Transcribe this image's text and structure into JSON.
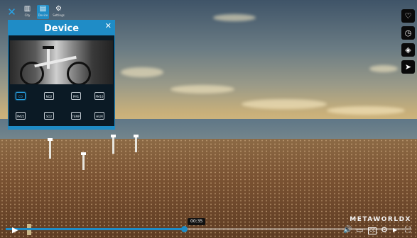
{
  "toolbar": {
    "items": [
      {
        "icon": "close-x-icon",
        "label": ""
      },
      {
        "icon": "building-icon",
        "label": "City"
      },
      {
        "icon": "device-icon",
        "label": "Device"
      },
      {
        "icon": "settings-icon",
        "label": "Settings"
      }
    ]
  },
  "device_panel": {
    "title": "Device",
    "close_label": "✕",
    "sensors": [
      {
        "label": "CO",
        "selected": true
      },
      {
        "label": "NO2",
        "selected": false
      },
      {
        "label": "PM1",
        "selected": false
      },
      {
        "label": "PM10",
        "selected": false
      },
      {
        "label": "PM25",
        "selected": false
      },
      {
        "label": "SO2",
        "selected": false
      },
      {
        "label": "TEMP",
        "selected": false
      },
      {
        "label": "HUM",
        "selected": false
      }
    ]
  },
  "side_buttons": [
    {
      "icon": "heart-icon",
      "glyph": "♡"
    },
    {
      "icon": "clock-icon",
      "glyph": "◷"
    },
    {
      "icon": "layers-icon",
      "glyph": "◈"
    },
    {
      "icon": "share-icon",
      "glyph": "➤"
    }
  ],
  "logo": "METAWORLDX",
  "player": {
    "time_tooltip": "00:35",
    "progress": 0.44,
    "controls": {
      "play": "▶",
      "volume": "🔊",
      "subtitles": "▭",
      "cc": "CC",
      "settings": "⚙",
      "youtube": "▶",
      "miniplayer": "▣",
      "fullscreen": "⛶"
    }
  },
  "colors": {
    "accent": "#1f8cc6",
    "panel_bg": "#0b1a25"
  }
}
